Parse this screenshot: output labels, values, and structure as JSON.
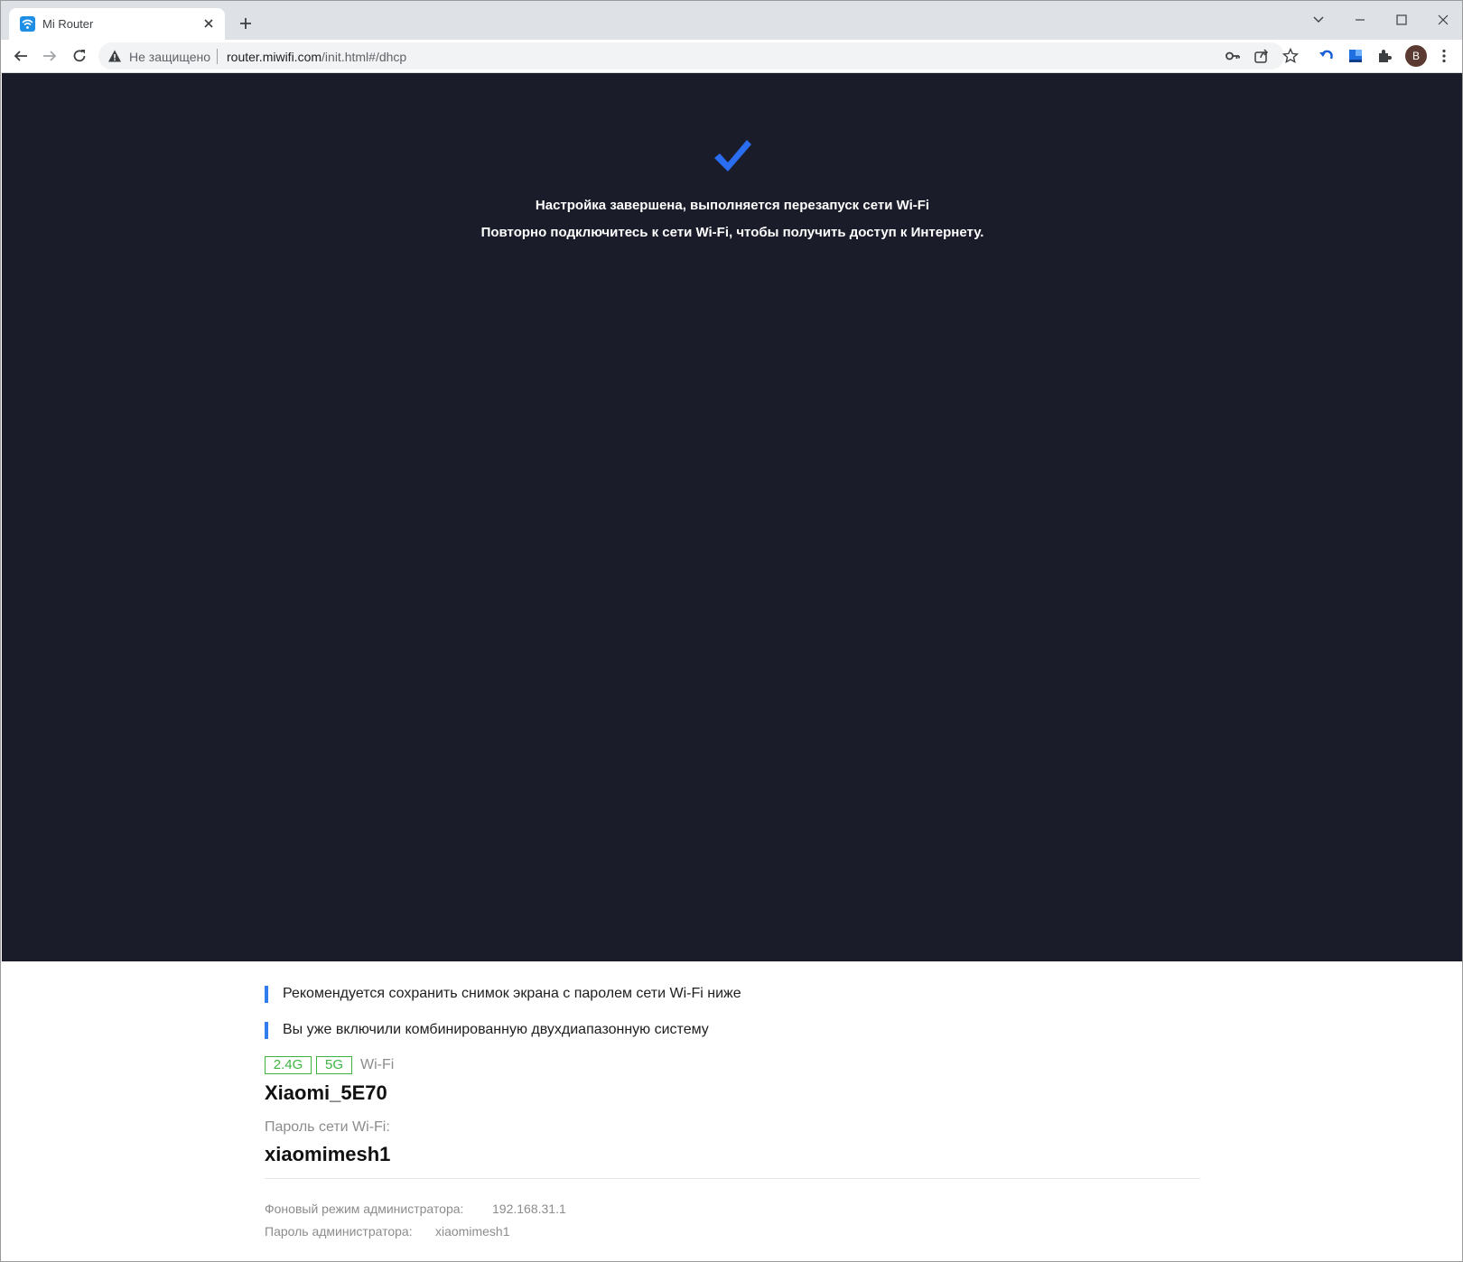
{
  "browser": {
    "tab": {
      "title": "Mi Router"
    },
    "omnibox": {
      "security_label": "Не защищено",
      "url_host": "router.miwifi.com",
      "url_path": "/init.html#/dhcp"
    },
    "profile_initial": "B"
  },
  "page": {
    "status": {
      "title": "Настройка завершена, выполняется перезапуск сети Wi-Fi",
      "subtitle": "Повторно подключитесь к сети Wi-Fi, чтобы получить доступ к Интернету."
    },
    "notes": [
      "Рекомендуется сохранить снимок экрана с паролем сети Wi-Fi ниже",
      "Вы уже включили комбинированную двухдиапазонную систему"
    ],
    "wifi": {
      "bands": [
        "2.4G",
        "5G"
      ],
      "label": "Wi-Fi",
      "ssid": "Xiaomi_5E70",
      "password_label": "Пароль сети Wi-Fi:",
      "password": "xiaomimesh1"
    },
    "admin": {
      "backend_label": "Фоновый режим администратора:",
      "backend_value": "192.168.31.1",
      "password_label": "Пароль администратора:",
      "password_value": "xiaomimesh1"
    }
  },
  "colors": {
    "hero_bg": "#1a1c2a",
    "accent_blue": "#2f7df0",
    "band_green": "#3db442"
  }
}
